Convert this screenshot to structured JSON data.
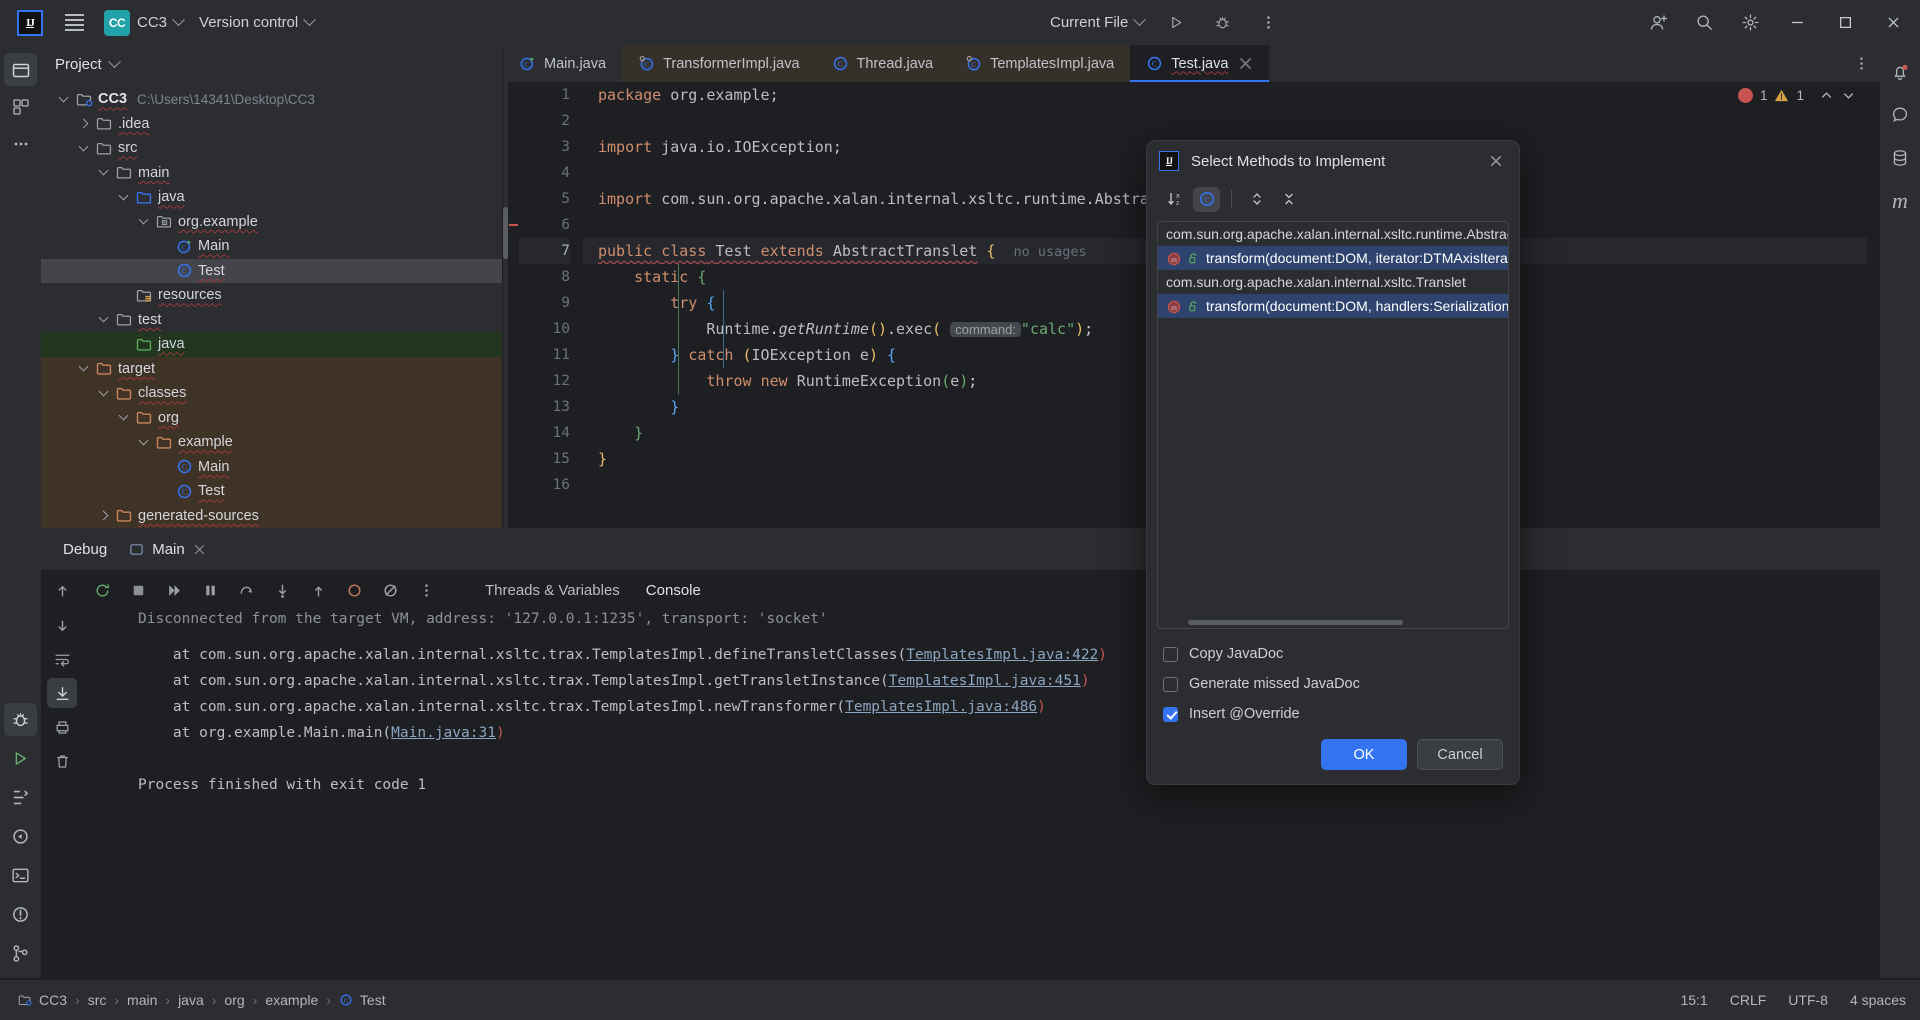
{
  "titlebar": {
    "logo": "IJ",
    "menu_icon": "hamburger-icon",
    "project_badge": "CC",
    "project_name": "CC3",
    "version_control": "Version control",
    "run_config": "Current File",
    "run_icon": "run-icon",
    "debug_icon": "debug-icon",
    "more_icon": "more-vertical-icon",
    "account_icon": "account-icon",
    "search_icon": "search-icon",
    "settings_icon": "settings-icon",
    "minimize": "minimize-icon",
    "maximize": "maximize-icon",
    "close": "close-icon"
  },
  "left_rail": {
    "items": [
      "project-icon",
      "commit-icon",
      "more-tools-icon"
    ],
    "bottom_items": [
      "debug-tool-icon",
      "run-tool-icon",
      "structure-icon",
      "services-icon",
      "terminal-icon",
      "problems-icon",
      "git-icon"
    ]
  },
  "right_rail": {
    "items": [
      "notifications-icon",
      "ai-assistant-icon",
      "database-icon",
      "maven-icon"
    ]
  },
  "project_panel": {
    "title": "Project",
    "tree": [
      {
        "label": "CC3",
        "path": "C:\\Users\\14341\\Desktop\\CC3",
        "depth": 0,
        "arrow": "expanded",
        "icon": "module-icon",
        "bold": true
      },
      {
        "label": ".idea",
        "depth": 1,
        "arrow": "collapsed",
        "icon": "folder-icon"
      },
      {
        "label": "src",
        "depth": 1,
        "arrow": "expanded",
        "icon": "folder-icon"
      },
      {
        "label": "main",
        "depth": 2,
        "arrow": "expanded",
        "icon": "folder-icon"
      },
      {
        "label": "java",
        "depth": 3,
        "arrow": "expanded",
        "icon": "source-root-icon"
      },
      {
        "label": "org.example",
        "depth": 4,
        "arrow": "expanded",
        "icon": "package-icon"
      },
      {
        "label": "Main",
        "depth": 5,
        "arrow": "none",
        "icon": "java-class-runnable-icon"
      },
      {
        "label": "Test",
        "depth": 5,
        "arrow": "none",
        "icon": "java-class-icon",
        "state": "selected"
      },
      {
        "label": "resources",
        "depth": 3,
        "arrow": "none",
        "icon": "resource-root-icon"
      },
      {
        "label": "test",
        "depth": 2,
        "arrow": "expanded",
        "icon": "folder-icon"
      },
      {
        "label": "java",
        "depth": 3,
        "arrow": "none",
        "icon": "test-source-root-icon",
        "state": "test-root"
      },
      {
        "label": "target",
        "depth": 1,
        "arrow": "expanded",
        "icon": "excluded-folder-icon",
        "state": "excluded"
      },
      {
        "label": "classes",
        "depth": 2,
        "arrow": "expanded",
        "icon": "excluded-folder-icon",
        "state": "excluded"
      },
      {
        "label": "org",
        "depth": 3,
        "arrow": "expanded",
        "icon": "excluded-folder-icon",
        "state": "excluded"
      },
      {
        "label": "example",
        "depth": 4,
        "arrow": "expanded",
        "icon": "excluded-folder-icon",
        "state": "excluded"
      },
      {
        "label": "Main",
        "depth": 5,
        "arrow": "none",
        "icon": "java-class-icon",
        "state": "excluded"
      },
      {
        "label": "Test",
        "depth": 5,
        "arrow": "none",
        "icon": "java-class-icon",
        "state": "excluded"
      },
      {
        "label": "generated-sources",
        "depth": 2,
        "arrow": "collapsed",
        "icon": "excluded-folder-icon",
        "state": "excluded"
      }
    ]
  },
  "editor": {
    "tabs": [
      {
        "label": "Main.java",
        "icon": "java-class-runnable-icon",
        "state": "normal"
      },
      {
        "label": "TransformerImpl.java",
        "icon": "java-class-library-icon",
        "state": "library"
      },
      {
        "label": "Thread.java",
        "icon": "java-class-icon",
        "state": "library"
      },
      {
        "label": "TemplatesImpl.java",
        "icon": "java-class-library-icon",
        "state": "library"
      },
      {
        "label": "Test.java",
        "icon": "java-class-icon",
        "state": "active"
      }
    ],
    "tab_options_icon": "more-vertical-icon",
    "inspection": {
      "errors": "1",
      "warnings": "1",
      "error_color": "#c75450",
      "warning_color": "#d9a343"
    },
    "line_numbers": [
      "1",
      "2",
      "3",
      "4",
      "5",
      "6",
      "7",
      "8",
      "9",
      "10",
      "11",
      "12",
      "13",
      "14",
      "15",
      "16"
    ],
    "current_line": 7,
    "code": {
      "l1_kw": "package",
      "l1_rest": " org.example;",
      "l3_kw": "import",
      "l3_rest": " java.io.IOException;",
      "l5_kw": "import",
      "l5_rest": " com.sun.org.apache.xalan.internal.xsltc.runtime.Abstrac",
      "l7_public": "public",
      "l7_class": "class",
      "l7_name": "Test",
      "l7_extends": "extends",
      "l7_super": "AbstractTranslet",
      "l7_brace": "{",
      "l7_usages": "no usages",
      "l8": "static",
      "l8_brace": "{",
      "l9": "try",
      "l9_brace": "{",
      "l10_recv": "Runtime",
      "l10_getrt": "getRuntime",
      "l10_exec": "exec",
      "l10_hint": "command:",
      "l10_str": "\"calc\"",
      "l11_close": "}",
      "l11_catch": "catch",
      "l11_ex": "IOException",
      "l11_var": "e",
      "l11_brace": "{",
      "l12_throw": "throw",
      "l12_new": "new",
      "l12_type": "RuntimeException",
      "l12_arg": "e",
      "l13": "}",
      "l14": "}",
      "l15": "}"
    }
  },
  "dialog": {
    "logo": "IJ",
    "title": "Select Methods to Implement",
    "close_icon": "close-icon",
    "toolbar": [
      {
        "name": "sort-alphabetically-icon",
        "active": false
      },
      {
        "name": "show-classes-icon",
        "active": true
      },
      {
        "name": "expand-all-icon",
        "active": false
      },
      {
        "name": "collapse-all-icon",
        "active": false
      }
    ],
    "groups": [
      {
        "class_name": "com.sun.org.apache.xalan.internal.xsltc.runtime.AbstractTranslet",
        "methods": [
          {
            "signature": "transform(document:DOM, iterator:DTMAxisIterator, hand",
            "selected": true,
            "icon": "method-abstract-icon",
            "visibility": "public-icon"
          }
        ]
      },
      {
        "class_name": "com.sun.org.apache.xalan.internal.xsltc.Translet",
        "methods": [
          {
            "signature": "transform(document:DOM, handlers:SerializationHandler",
            "selected": true,
            "icon": "method-abstract-icon",
            "visibility": "public-icon"
          }
        ]
      }
    ],
    "options": [
      {
        "label": "Copy JavaDoc",
        "mnemonic": "J",
        "checked": false
      },
      {
        "label": "Generate missed JavaDoc",
        "mnemonic": "",
        "checked": false
      },
      {
        "label": "Insert @Override",
        "mnemonic": "O",
        "checked": true
      }
    ],
    "ok_label": "OK",
    "cancel_label": "Cancel"
  },
  "debug": {
    "panel_title": "Debug",
    "tab_label": "Main",
    "tab_icon": "run-config-icon",
    "tab_close": "close-icon",
    "subtabs": [
      "Threads & Variables",
      "Console"
    ],
    "active_subtab": "Console",
    "toolbar_icons": [
      "rerun-icon",
      "stop-icon",
      "resume-icon",
      "pause-icon",
      "step-over-icon",
      "step-into-icon",
      "step-out-icon",
      "mute-breakpoints-icon",
      "view-breakpoints-icon",
      "more-vertical-icon"
    ],
    "side_icons": [
      "step-up-icon",
      "step-down-icon",
      "frames-icon",
      "evaluate-icon",
      "print-icon",
      "soft-wrap-icon",
      "scroll-end-icon",
      "trash-icon"
    ],
    "console_lines": [
      {
        "text": "Disconnected from the target VM, address: '127.0.0.1:1235', transport: 'socket'",
        "clipped": true
      },
      {
        "prefix": "    at com.sun.org.apache.xalan.internal.xsltc.trax.TemplatesImpl.defineTransletClasses(",
        "link": "TemplatesImpl.java:422",
        "suffix": ")"
      },
      {
        "prefix": "    at com.sun.org.apache.xalan.internal.xsltc.trax.TemplatesImpl.getTransletInstance(",
        "link": "TemplatesImpl.java:451",
        "suffix": ")"
      },
      {
        "prefix": "    at com.sun.org.apache.xalan.internal.xsltc.trax.TemplatesImpl.newTransformer(",
        "link": "TemplatesImpl.java:486",
        "suffix": ")"
      },
      {
        "prefix": "    at org.example.Main.main(",
        "link": "Main.java:31",
        "suffix": ")"
      },
      {
        "text": ""
      },
      {
        "text": "Process finished with exit code 1"
      }
    ]
  },
  "statusbar": {
    "breadcrumbs": [
      {
        "label": "CC3",
        "icon": "module-icon"
      },
      {
        "label": "src"
      },
      {
        "label": "main"
      },
      {
        "label": "java"
      },
      {
        "label": "org"
      },
      {
        "label": "example"
      },
      {
        "label": "Test",
        "icon": "java-class-icon"
      }
    ],
    "caret": "15:1",
    "line_sep": "CRLF",
    "encoding": "UTF-8",
    "indent": "4 spaces"
  }
}
